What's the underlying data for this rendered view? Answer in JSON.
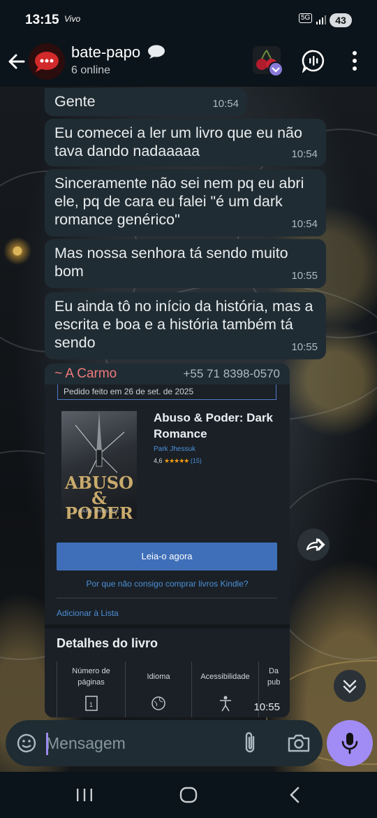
{
  "status_bar": {
    "time": "13:15",
    "carrier": "Vivo",
    "network": "5G",
    "battery": "43"
  },
  "header": {
    "title": "bate-papo",
    "subtitle": "6 online"
  },
  "messages": [
    {
      "text": "Gente",
      "time": "10:54"
    },
    {
      "text": "Eu comecei a ler um livro que eu não tava dando nadaaaaa",
      "time": "10:54"
    },
    {
      "text": "Sinceramente não sei nem pq eu abri ele, pq de cara eu falei \"é um dark romance genérico\"",
      "time": "10:54"
    },
    {
      "text": "Mas nossa senhora tá sendo muito bom",
      "time": "10:55"
    },
    {
      "text": "Eu ainda tô no início da história, mas a escrita e boa e a história também tá sendo",
      "time": "10:55"
    }
  ],
  "forwarded": {
    "sender_name": "~ A  Carmo",
    "sender_phone": "+55 71 8398-0570",
    "time": "10:55",
    "order_text": "Pedido feito em 26 de set. de 2025",
    "book_title": "Abuso & Poder: Dark Romance",
    "book_author": "Park Jhessuk",
    "rating": "4,6",
    "stars": "★★★★★",
    "rating_count": "(15)",
    "cover_title": "ABUSO & PODER",
    "cover_author": "PARK JHESSUK",
    "read_button": "Leia-o agora",
    "kindle_link": "Por que não consigo comprar livros Kindle?",
    "list_link": "Adicionar à Lista",
    "details_title": "Detalhes do livro",
    "details": [
      "Número de páginas",
      "Idioma",
      "Acessibilidade",
      "Da pub"
    ]
  },
  "input": {
    "placeholder": "Mensagem"
  },
  "colors": {
    "accent": "#a18cf5",
    "bubble": "#202c33",
    "sender": "#f07a7a",
    "link": "#4d8fd6"
  }
}
